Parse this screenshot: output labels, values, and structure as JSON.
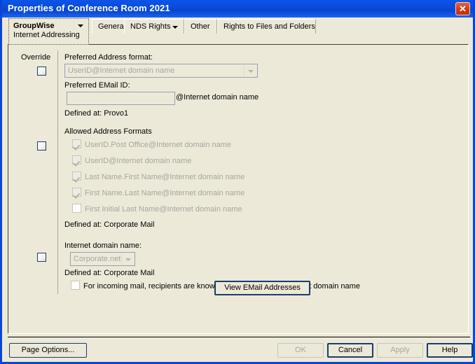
{
  "window": {
    "title": "Properties of Conference Room 2021",
    "close_icon": "close-icon",
    "titlebar_color": "#0a4ad8",
    "face_color": "#ece9d8",
    "frame_color": "#0a46d2"
  },
  "tabs": [
    {
      "label": "GroupWise",
      "sublabel": "Internet Addressing",
      "selected": true,
      "has_dropdown": true
    },
    {
      "label": "General",
      "selected": false,
      "has_dropdown": false
    },
    {
      "label": "NDS Rights",
      "selected": false,
      "has_dropdown": true
    },
    {
      "label": "Other",
      "selected": false,
      "has_dropdown": false
    },
    {
      "label": "Rights to Files and Folders",
      "selected": false,
      "has_dropdown": false
    }
  ],
  "panel": {
    "override_header": "Override",
    "preferred_address_format": {
      "label": "Preferred Address format:",
      "value": "UserID@Internet domain name",
      "enabled": false,
      "override_checked": false
    },
    "preferred_email_id": {
      "label": "Preferred EMail ID:",
      "value": "",
      "suffix": "@Internet domain name",
      "enabled": false
    },
    "defined_at_1": "Defined at:  Provo1",
    "allowed_address_formats": {
      "label": "Allowed Address Formats",
      "override_checked": false,
      "items": [
        {
          "label": "UserID.Post Office@Internet domain name",
          "checked": true,
          "enabled": false
        },
        {
          "label": "UserID@Internet domain name",
          "checked": true,
          "enabled": false
        },
        {
          "label": "Last Name.First Name@Internet domain name",
          "checked": true,
          "enabled": false
        },
        {
          "label": "First Name.Last Name@Internet domain name",
          "checked": true,
          "enabled": false
        },
        {
          "label": "First Initial Last Name@Internet domain name",
          "checked": false,
          "enabled": false
        }
      ]
    },
    "defined_at_2": "Defined at:  Corporate Mail",
    "internet_domain_name": {
      "label": "Internet domain name:",
      "value": "Corporate.net",
      "enabled": false,
      "override_checked": false
    },
    "defined_at_3": "Defined at:  Corporate Mail",
    "exclusive_checkbox": {
      "label": "For incoming mail, recipients are known exclusively by this Internet domain name",
      "checked": false,
      "enabled": false
    },
    "view_email_button": "View EMail Addresses"
  },
  "footer": {
    "page_options": "Page Options...",
    "ok": "OK",
    "cancel": "Cancel",
    "apply": "Apply",
    "help": "Help",
    "ok_enabled": false,
    "apply_enabled": false
  }
}
